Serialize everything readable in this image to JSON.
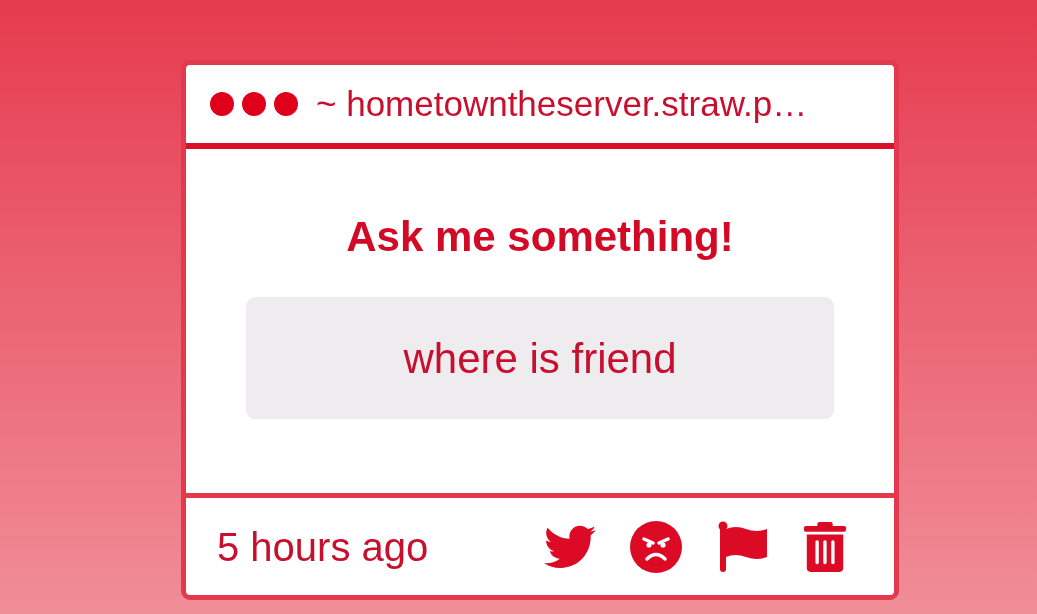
{
  "title_bar": {
    "address": "~ hometowntheserver.straw.p…"
  },
  "question": {
    "heading": "Ask me something!",
    "text": "where is friend"
  },
  "footer": {
    "time": "5 hours ago"
  }
}
